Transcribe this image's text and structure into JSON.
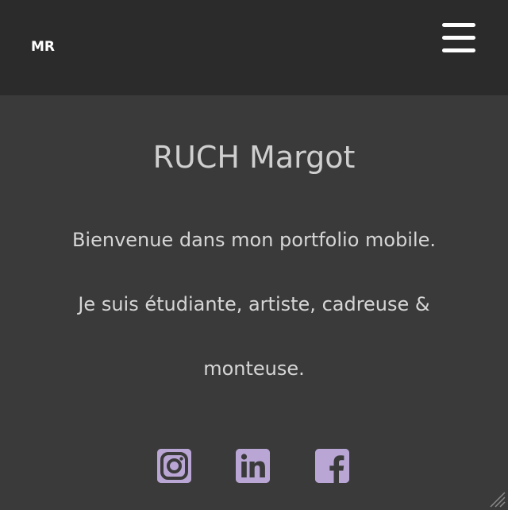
{
  "header": {
    "brand": "MR",
    "menu_icon": "hamburger-menu-icon"
  },
  "main": {
    "title": "RUCH Margot",
    "intro_line1": "Bienvenue dans mon portfolio mobile.",
    "intro_line2": "Je suis étudiante, artiste, cadreuse & monteuse."
  },
  "socials": [
    {
      "name": "Instagram",
      "icon": "instagram-icon"
    },
    {
      "name": "LinkedIn",
      "icon": "linkedin-icon"
    },
    {
      "name": "Facebook",
      "icon": "facebook-icon"
    }
  ],
  "colors": {
    "header_bg": "#2b2b2b",
    "page_bg": "#3a3a3a",
    "text": "#d6d6d6",
    "accent": "#b9a6d4"
  }
}
